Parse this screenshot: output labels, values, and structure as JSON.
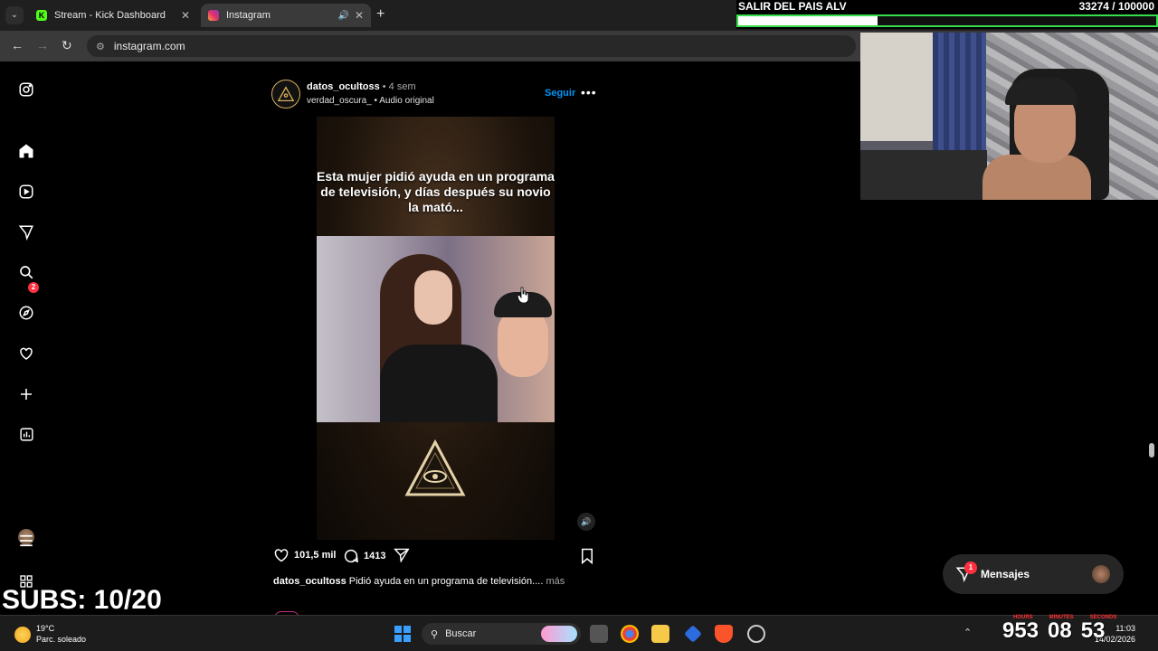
{
  "browser": {
    "tabs": [
      {
        "label": "Stream - Kick Dashboard",
        "icon": "kick-logo-icon",
        "favicon_letter": "K"
      },
      {
        "label": "Instagram",
        "icon": "instagram-logo-icon",
        "active": true,
        "audio": true
      }
    ],
    "url": "instagram.com"
  },
  "stream_overlay": {
    "goal_title": "SALIR DEL PAIS ALV",
    "goal_count": "33274  / 100000",
    "goal_progress": 0.333,
    "subs": "SUBS: 10/20",
    "timer": {
      "labels": [
        "HOURS",
        "MINUTES",
        "SECONDS"
      ],
      "hours": "953",
      "minutes": "08",
      "seconds": "53"
    }
  },
  "sidebar": {
    "items": [
      {
        "name": "instagram-logo-icon"
      },
      {
        "name": "home-icon"
      },
      {
        "name": "reels-icon"
      },
      {
        "name": "direct-icon",
        "badge": "2"
      },
      {
        "name": "search-icon"
      },
      {
        "name": "explore-icon"
      },
      {
        "name": "notifications-icon"
      },
      {
        "name": "create-icon"
      },
      {
        "name": "dashboard-icon"
      },
      {
        "name": "profile-avatar"
      },
      {
        "name": "more-menu-icon"
      },
      {
        "name": "also-from-meta-icon"
      }
    ]
  },
  "post": {
    "username": "datos_ocultoss",
    "time": " • 4 sem",
    "audio_line": "verdad_oscura_ • Audio original",
    "follow_label": "Seguir",
    "reel_text": "Esta mujer pidió ayuda en un programa de televisión, y días después su novio la mató...",
    "likes": "101,5 mil",
    "comments": "1413",
    "caption_user": "datos_ocultoss",
    "caption_text": " Pidió ayuda en un programa de televisión....",
    "caption_more": " más"
  },
  "messages": {
    "label": "Mensajes",
    "badge": "1"
  },
  "taskbar": {
    "weather_temp": "19°C",
    "weather_desc": "Parc. soleado",
    "search_label": "Buscar",
    "time": "11:03",
    "date": "14/02/2026"
  },
  "colors": {
    "accent_blue": "#0095f6",
    "badge_red": "#ff3040",
    "goal_green": "#35e04a"
  }
}
